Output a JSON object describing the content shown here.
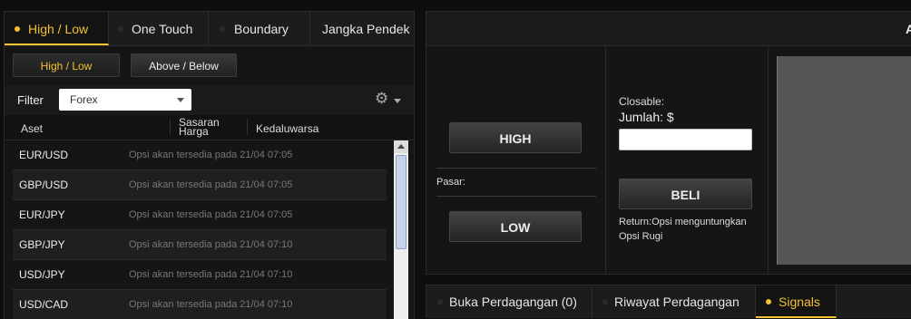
{
  "left_panel": {
    "tabs": [
      {
        "label": "High / Low",
        "active": true
      },
      {
        "label": "One Touch",
        "active": false
      },
      {
        "label": "Boundary",
        "active": false
      },
      {
        "label": "Jangka Pendek",
        "active": false
      }
    ],
    "sub_buttons": [
      {
        "label": "High / Low",
        "active": true
      },
      {
        "label": "Above / Below",
        "active": false
      }
    ],
    "filter": {
      "label": "Filter",
      "selected": "Forex"
    },
    "columns": {
      "asset": "Aset",
      "target_price_line1": "Sasaran",
      "target_price_line2": "Harga",
      "expiry": "Kedaluwarsa"
    },
    "rows": [
      {
        "asset": "EUR/USD",
        "note": "Opsi akan tersedia pada 21/04 07:05"
      },
      {
        "asset": "GBP/USD",
        "note": "Opsi akan tersedia pada 21/04 07:05"
      },
      {
        "asset": "EUR/JPY",
        "note": "Opsi akan tersedia pada 21/04 07:05"
      },
      {
        "asset": "GBP/JPY",
        "note": "Opsi akan tersedia pada 21/04 07:10"
      },
      {
        "asset": "USD/JPY",
        "note": "Opsi akan tersedia pada 21/04 07:10"
      },
      {
        "asset": "USD/CAD",
        "note": "Opsi akan tersedia pada 21/04 07:10"
      }
    ]
  },
  "trade_panel": {
    "header_letter": "A",
    "high_button": "HIGH",
    "low_button": "LOW",
    "market_label": "Pasar:",
    "closable_label": "Closable:",
    "amount_label": "Jumlah: $",
    "amount_value": "",
    "buy_button": "BELI",
    "return_line1": "Return:Opsi menguntungkan",
    "return_line2": "Opsi Rugi"
  },
  "bottom_tabs": [
    {
      "label": "Buka Perdagangan (0)",
      "active": false
    },
    {
      "label": "Riwayat Perdagangan",
      "active": false
    },
    {
      "label": "Signals",
      "active": true
    }
  ],
  "colors": {
    "accent": "#f2c230",
    "background": "#0e0e0e",
    "panel": "#151515"
  },
  "icons": {
    "settings": "gear-icon",
    "dropdown": "chevron-down-icon",
    "tab_marker": "dot-icon"
  }
}
